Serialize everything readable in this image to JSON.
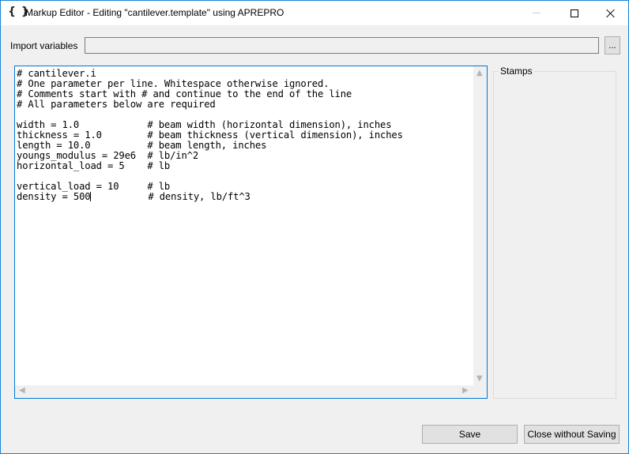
{
  "window": {
    "app_icon": "{ }",
    "title": "Markup Editor - Editing \"cantilever.template\" using APREPRO",
    "controls": {
      "minimize_icon": "minimize-icon",
      "maximize_icon": "maximize-icon",
      "close_icon": "close-icon"
    }
  },
  "import": {
    "label": "Import variables",
    "value": "",
    "browse_label": "..."
  },
  "editor": {
    "lines": [
      "# cantilever.i",
      "# One parameter per line. Whitespace otherwise ignored.",
      "# Comments start with # and continue to the end of the line",
      "# All parameters below are required",
      "",
      "width = 1.0            # beam width (horizontal dimension), inches",
      "thickness = 1.0        # beam thickness (vertical dimension), inches",
      "length = 10.0          # beam length, inches",
      "youngs_modulus = 29e6  # lb/in^2",
      "horizontal_load = 5    # lb",
      "",
      "vertical_load = 10     # lb"
    ],
    "cursor_line_before": "density = 500",
    "cursor_line_after": "          # density, lb/ft^3",
    "scrollbar_icons": {
      "up": "▲",
      "down": "▼",
      "left": "◀",
      "right": "▶"
    }
  },
  "stamps": {
    "title": "Stamps"
  },
  "buttons": {
    "save": "Save",
    "close_without_saving": "Close without Saving"
  }
}
